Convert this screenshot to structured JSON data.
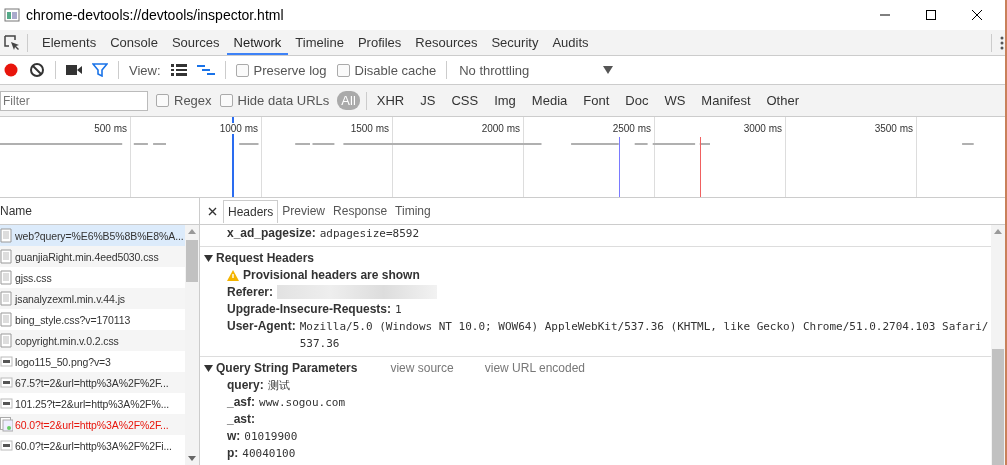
{
  "window": {
    "title": "chrome-devtools://devtools/inspector.html"
  },
  "tabs": [
    {
      "label": "Elements",
      "selected": false
    },
    {
      "label": "Console",
      "selected": false
    },
    {
      "label": "Sources",
      "selected": false
    },
    {
      "label": "Network",
      "selected": true
    },
    {
      "label": "Timeline",
      "selected": false
    },
    {
      "label": "Profiles",
      "selected": false
    },
    {
      "label": "Resources",
      "selected": false
    },
    {
      "label": "Security",
      "selected": false
    },
    {
      "label": "Audits",
      "selected": false
    }
  ],
  "toolbar": {
    "recording": true,
    "filter_on": true,
    "view_label": "View:",
    "large_rows": false,
    "overview": true,
    "checkboxes": [
      {
        "label": "Preserve log",
        "checked": false
      },
      {
        "label": "Disable cache",
        "checked": false
      }
    ],
    "throttling": "No throttling"
  },
  "filter_bar": {
    "placeholder": "Filter",
    "checkboxes": [
      {
        "label": "Regex",
        "checked": false
      },
      {
        "label": "Hide data URLs",
        "checked": false
      }
    ],
    "types": [
      {
        "label": "All",
        "selected": true
      },
      {
        "label": "XHR",
        "selected": false
      },
      {
        "label": "JS",
        "selected": false
      },
      {
        "label": "CSS",
        "selected": false
      },
      {
        "label": "Img",
        "selected": false
      },
      {
        "label": "Media",
        "selected": false
      },
      {
        "label": "Font",
        "selected": false
      },
      {
        "label": "Doc",
        "selected": false
      },
      {
        "label": "WS",
        "selected": false
      },
      {
        "label": "Manifest",
        "selected": false
      },
      {
        "label": "Other",
        "selected": false
      }
    ]
  },
  "overview": {
    "ticks": [
      "500 ms",
      "1000 ms",
      "1500 ms",
      "2000 ms",
      "2500 ms",
      "3000 ms",
      "3500 ms"
    ]
  },
  "requests": {
    "column": "Name",
    "rows": [
      {
        "name": "web?query=%E6%B5%8B%E8%A...",
        "kind": "document",
        "selected": true,
        "failed": false
      },
      {
        "name": "guanjiaRight.min.4eed5030.css",
        "kind": "document",
        "selected": false,
        "failed": false
      },
      {
        "name": "gjss.css",
        "kind": "document",
        "selected": false,
        "failed": false
      },
      {
        "name": "jsanalyzexml.min.v.44.js",
        "kind": "document",
        "selected": false,
        "failed": false
      },
      {
        "name": "bing_style.css?v=170113",
        "kind": "document",
        "selected": false,
        "failed": false
      },
      {
        "name": "copyright.min.v.0.2.css",
        "kind": "document",
        "selected": false,
        "failed": false
      },
      {
        "name": "logo115_50.png?v=3",
        "kind": "image",
        "selected": false,
        "failed": false
      },
      {
        "name": "67.5?t=2&url=http%3A%2F%2F...",
        "kind": "image",
        "selected": false,
        "failed": false
      },
      {
        "name": "101.25?t=2&url=http%3A%2F%...",
        "kind": "image",
        "selected": false,
        "failed": false
      },
      {
        "name": "60.0?t=2&url=http%3A%2F%2F...",
        "kind": "broken",
        "selected": false,
        "failed": true
      },
      {
        "name": "60.0?t=2&url=http%3A%2F%2Fi...",
        "kind": "image",
        "selected": false,
        "failed": false
      }
    ]
  },
  "details": {
    "tabs": [
      {
        "label": "Headers",
        "selected": true
      },
      {
        "label": "Preview",
        "selected": false
      },
      {
        "label": "Response",
        "selected": false
      },
      {
        "label": "Timing",
        "selected": false
      }
    ],
    "top_row": {
      "key": "x_ad_pagesize:",
      "value": "adpagesize=8592"
    },
    "sections": [
      {
        "title": "Request Headers",
        "expanded": true,
        "warning": "Provisional headers are shown",
        "rows": [
          {
            "key": "Referer:",
            "value": "",
            "blurred": true
          },
          {
            "key": "Upgrade-Insecure-Requests:",
            "value": "1",
            "blurred": false
          },
          {
            "key": "User-Agent:",
            "value": "Mozilla/5.0 (Windows NT 10.0; WOW64) AppleWebKit/537.36 (KHTML, like Gecko) Chrome/51.0.2704.103 Safari/537.36",
            "blurred": false
          }
        ]
      },
      {
        "title": "Query String Parameters",
        "expanded": true,
        "links": [
          "view source",
          "view URL encoded"
        ],
        "rows": [
          {
            "key": "query:",
            "value": "测试",
            "blurred": false
          },
          {
            "key": "_asf:",
            "value": "www.sogou.com",
            "blurred": false
          },
          {
            "key": "_ast:",
            "value": "",
            "blurred": false
          },
          {
            "key": "w:",
            "value": "01019900",
            "blurred": false
          },
          {
            "key": "p:",
            "value": "40040100",
            "blurred": false
          }
        ]
      }
    ]
  }
}
